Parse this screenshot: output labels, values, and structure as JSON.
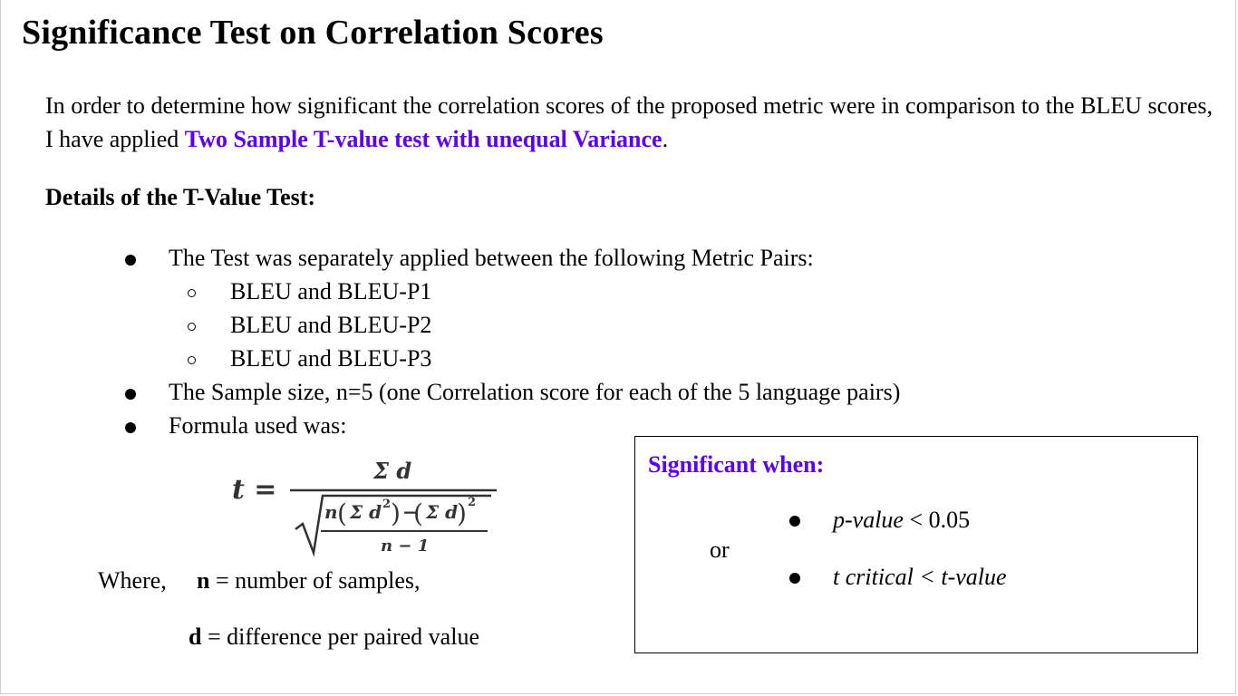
{
  "title": "Significance Test on Correlation Scores",
  "intro": {
    "text_before": "In order to determine how significant the correlation scores of the proposed metric were in comparison to the BLEU scores, I have applied ",
    "link_text": "Two Sample T-value test with unequal Variance",
    "text_after": "."
  },
  "details_heading": "Details of the T-Value Test:",
  "bullets": {
    "b1": "The Test was separately applied between the following Metric Pairs:",
    "sub1": "BLEU and BLEU-P1",
    "sub2": "BLEU and BLEU-P2",
    "sub3": "BLEU and BLEU-P3",
    "b2": "The Sample size, n=5 (one Correlation score for each of the 5 language pairs)",
    "b3": "Formula used was:"
  },
  "formula": {
    "lhs": "t =",
    "numerator": "Σ d",
    "denominator_n": "n",
    "denominator_sum_sq": "Σ d",
    "denominator_sq_sum": "Σ d",
    "exp2": "2",
    "minus": "−",
    "denominator_bottom": "n − 1"
  },
  "where": {
    "label": "Where,",
    "n_var": "n",
    "n_desc": " = number of samples,",
    "d_var": "d",
    "d_desc": " = difference per paired value"
  },
  "significance_box": {
    "title": "Significant when:",
    "cond1_italic": "p-value",
    "cond1_rest": " < 0.05",
    "or": "or",
    "cond2": "t critical < t-value"
  },
  "colors": {
    "accent": "#5b00ea",
    "text": "#000000",
    "background": "#ffffff"
  }
}
